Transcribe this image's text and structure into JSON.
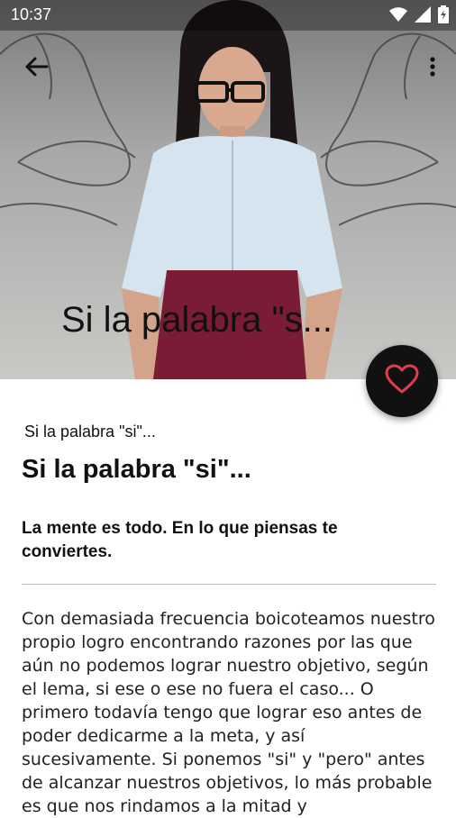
{
  "status_bar": {
    "time": "10:37"
  },
  "hero": {
    "title": "Si la palabra \"s..."
  },
  "article": {
    "subtitle_small": "Si la palabra \"si\"...",
    "subtitle_large": "Si la palabra \"si\"...",
    "lead": "La mente es todo. En lo que piensas te conviertes.",
    "body": "Con demasiada frecuencia boicoteamos nuestro propio logro encontrando razones por las que aún no podemos lograr nuestro objetivo, según el lema, si ese o ese no fuera el caso... O primero todavía tengo que lograr eso antes de poder dedicarme a la meta, y así sucesivamente. Si ponemos \"si\" y \"pero\" antes de alcanzar nuestros objetivos, lo más probable es que nos rindamos a la mitad y"
  },
  "icons": {
    "back": "arrow-left-icon",
    "more": "more-vert-icon",
    "favorite": "heart-icon",
    "wifi": "wifi-icon",
    "signal": "signal-icon",
    "battery": "battery-icon"
  },
  "colors": {
    "fab_bg": "#111111",
    "heart": "#e53950"
  }
}
